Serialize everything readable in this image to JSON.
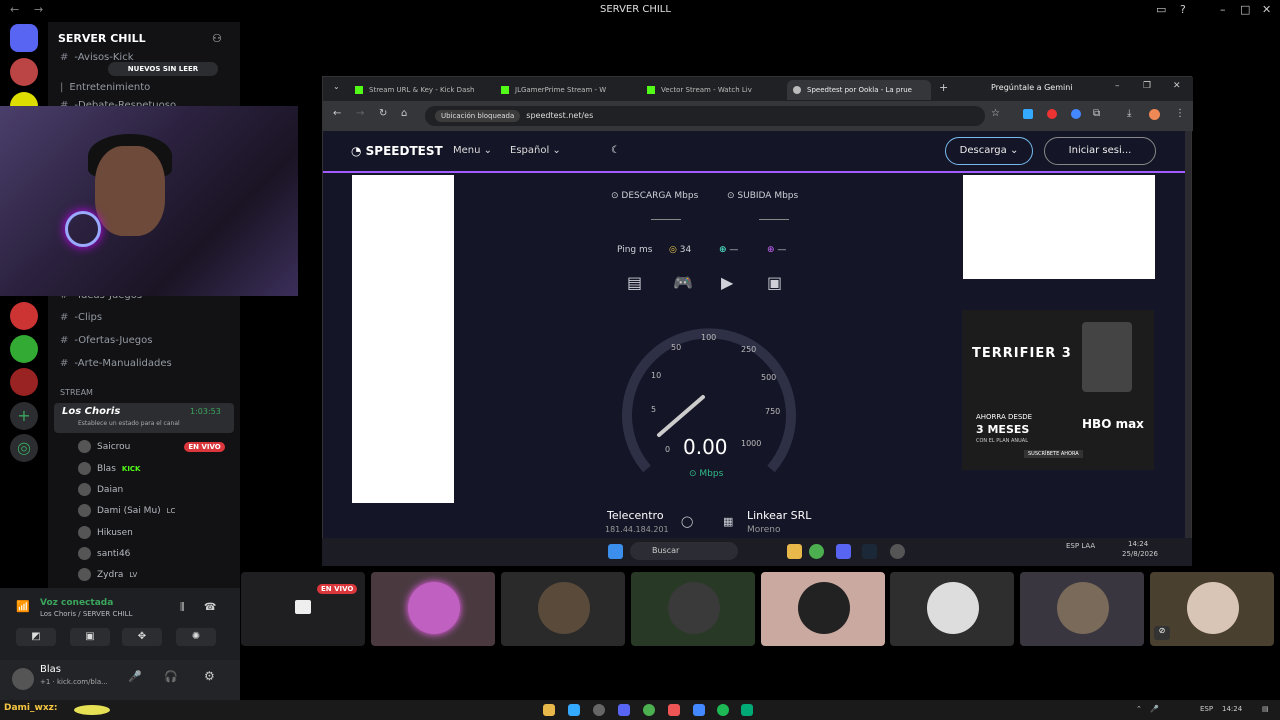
{
  "window": {
    "title": "SERVER CHILL"
  },
  "server": {
    "name": "SERVER CHILL",
    "new_unread": "NUEVOS SIN LEER",
    "channels": [
      {
        "name": "-Avisos-Kick"
      },
      {
        "name": "Entretenimiento"
      },
      {
        "name": "-Debate-Respetuoso"
      },
      {
        "name": "-Ideas-Juegos"
      },
      {
        "name": "-Clips"
      },
      {
        "name": "-Ofertas-Juegos"
      },
      {
        "name": "-Arte-Manualidades"
      }
    ],
    "stream_category": "STREAM",
    "voice_channel": {
      "name": "Los Choris",
      "timer": "1:03:53",
      "status": "Establece un estado para el canal"
    },
    "members": [
      {
        "name": "Saicrou",
        "badge": "EN VIVO"
      },
      {
        "name": "Blas",
        "badge": "KICK"
      },
      {
        "name": "Daian",
        "badge": ""
      },
      {
        "name": "Dami (Sai Mu)",
        "badge": "LC"
      },
      {
        "name": "Hikusen",
        "badge": ""
      },
      {
        "name": "santi46",
        "badge": ""
      },
      {
        "name": "Zydra",
        "badge": "LV"
      }
    ]
  },
  "voice_panel": {
    "status": "Voz conectada",
    "location": "Los Choris / SERVER CHILL",
    "user": "Blas",
    "user_status": "+1 · kick.com/bla..."
  },
  "browser": {
    "tabs": [
      {
        "label": "Stream URL & Key - Kick Dash"
      },
      {
        "label": "JLGamerPrime Stream - W"
      },
      {
        "label": "Vector Stream - Watch Liv"
      },
      {
        "label": "Speedtest por Ookla - La prue"
      }
    ],
    "gemini": "Pregúntale a Gemini",
    "address": {
      "lock_label": "Ubicación bloqueada",
      "url": "speedtest.net/es"
    }
  },
  "speedtest": {
    "logo": "SPEEDTEST",
    "menu": "Menu",
    "language": "Español",
    "download_btn": "Descarga",
    "login_btn": "Iniciar sesi...",
    "download_label": "DESCARGA Mbps",
    "upload_label": "SUBIDA Mbps",
    "ping_label": "Ping ms",
    "ping_value": "34",
    "jitter_value": "—",
    "loss_value": "—",
    "gauge_ticks": [
      "0",
      "1",
      "5",
      "10",
      "50",
      "100",
      "250",
      "500",
      "750",
      "1000"
    ],
    "speed": "0.00",
    "unit": "Mbps",
    "isp": {
      "name": "Telecentro",
      "ip": "181.44.184.201"
    },
    "server": {
      "name": "Linkear SRL",
      "location": "Moreno"
    }
  },
  "ad": {
    "title": "TERRIFIER 3",
    "line1": "AHORRA DESDE",
    "line2": "3 MESES",
    "line3": "CON EL PLAN ANUAL",
    "brand": "HBO max",
    "cta": "SUSCRÍBETE AHORA"
  },
  "inner_taskbar": {
    "search": "Buscar",
    "lang": "ESP LAA",
    "time": "14:24",
    "date": "25/8/2026"
  },
  "tiles": [
    {
      "label": "EN VIVO",
      "color": "#1f1f22"
    },
    {
      "color": "#4a3a40"
    },
    {
      "color": "#2a2a2a"
    },
    {
      "color": "#283a25"
    },
    {
      "color": "#c9a9a0"
    },
    {
      "color": "#2e2e2e"
    },
    {
      "color": "#3a3640"
    },
    {
      "color": "#4a4030"
    }
  ],
  "taskbar": {
    "user": "Dami_wxz:",
    "lang": "ESP",
    "time": "14:24"
  },
  "colors": {
    "discord_green": "#3ba55d",
    "speedtest_purple": "#a05cff",
    "live_red": "#da373c"
  }
}
